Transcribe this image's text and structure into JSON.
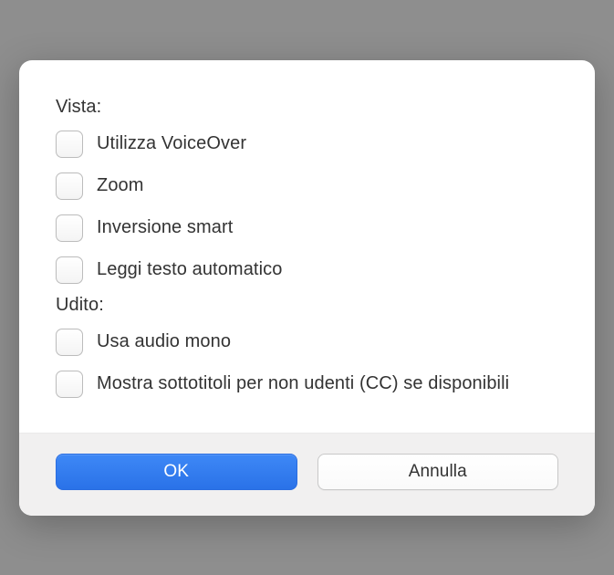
{
  "sections": {
    "vision": {
      "label": "Vista:",
      "options": [
        {
          "label": "Utilizza VoiceOver",
          "checked": false
        },
        {
          "label": "Zoom",
          "checked": false
        },
        {
          "label": "Inversione smart",
          "checked": false
        },
        {
          "label": "Leggi testo automatico",
          "checked": false
        }
      ]
    },
    "hearing": {
      "label": "Udito:",
      "options": [
        {
          "label": "Usa audio mono",
          "checked": false
        },
        {
          "label": "Mostra sottotitoli per non udenti (CC) se disponibili",
          "checked": false
        }
      ]
    }
  },
  "buttons": {
    "ok": "OK",
    "cancel": "Annulla"
  }
}
